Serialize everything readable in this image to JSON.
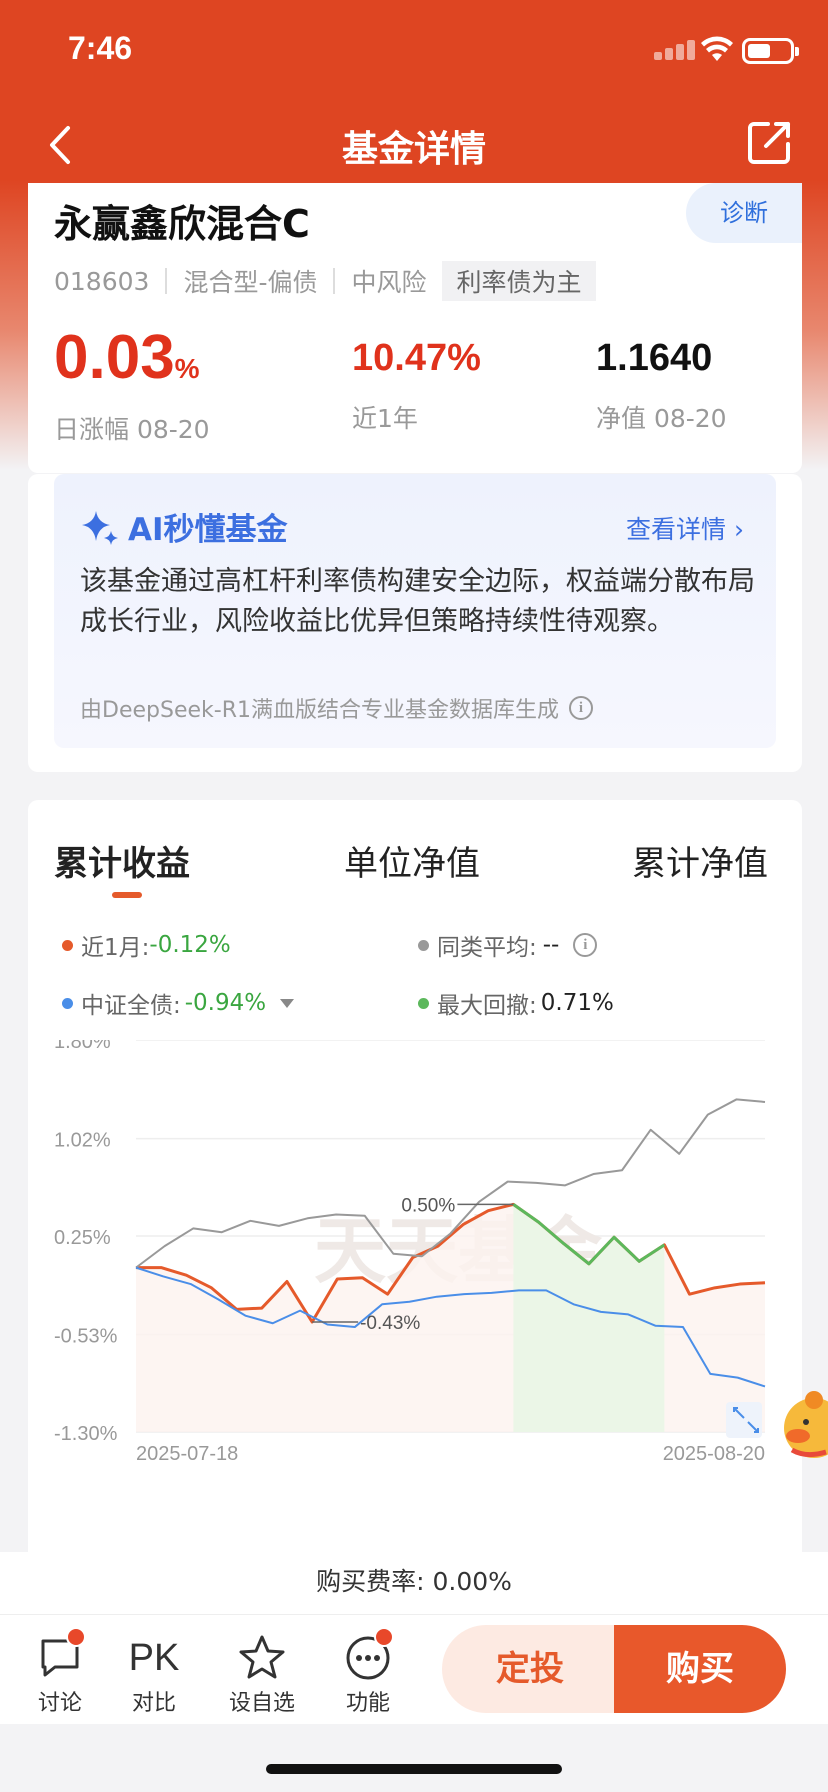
{
  "status_bar": {
    "time": "7:46"
  },
  "nav": {
    "title": "基金详情"
  },
  "fund": {
    "name": "永赢鑫欣混合C",
    "diagnose_label": "诊断",
    "code": "018603",
    "type": "混合型-偏债",
    "risk": "中风险",
    "tag": "利率债为主",
    "daily_change": "0.03",
    "daily_change_unit": "%",
    "daily_label": "日涨幅 08-20",
    "year_return": "10.47%",
    "year_label": "近1年",
    "nav_value": "1.1640",
    "nav_label": "净值 08-20"
  },
  "ai": {
    "title": "AI秒懂基金",
    "more": "查看详情",
    "text": "该基金通过高杠杆利率债构建安全边际，权益端分散布局成长行业，风险收益比优异但策略持续性待观察。",
    "footer": "由DeepSeek-R1满血版结合专业基金数据库生成"
  },
  "chart_tabs": [
    "累计收益",
    "单位净值",
    "累计净值"
  ],
  "legend": {
    "month_label": "近1月:",
    "month_value": "-0.12%",
    "peer_label": "同类平均:",
    "peer_value": "--",
    "index_label": "中证全债:",
    "index_value": "-0.94%",
    "drawdown_label": "最大回撤:",
    "drawdown_value": "0.71%"
  },
  "colors": {
    "fund": "#e55a2b",
    "peer": "#999999",
    "index": "#4a8ee8",
    "drawdown": "#5cb85c",
    "accent": "#de4522"
  },
  "chart_data": {
    "type": "line",
    "x_start": "2025-07-18",
    "x_end": "2025-08-20",
    "ylim": [
      -1.3,
      1.8
    ],
    "yticks": [
      "1.80%",
      "1.02%",
      "0.25%",
      "-0.53%",
      "-1.30%"
    ],
    "ytick_values": [
      1.8,
      1.02,
      0.25,
      -0.53,
      -1.3
    ],
    "watermark": "天天基金",
    "series": [
      {
        "name": "近1月",
        "values": [
          0.0,
          0.0,
          -0.06,
          -0.16,
          -0.33,
          -0.32,
          -0.11,
          -0.43,
          -0.09,
          -0.08,
          -0.21,
          0.08,
          0.17,
          0.34,
          0.45,
          0.5,
          0.36,
          0.19,
          0.03,
          0.24,
          0.05,
          0.18,
          -0.21,
          -0.16,
          -0.13,
          -0.12
        ]
      },
      {
        "name": "同类平均",
        "values": [
          0.0,
          0.17,
          0.31,
          0.28,
          0.37,
          0.33,
          0.39,
          0.42,
          0.41,
          0.11,
          0.09,
          0.27,
          0.52,
          0.68,
          0.67,
          0.65,
          0.74,
          0.77,
          1.09,
          0.9,
          1.21,
          1.33,
          1.31
        ]
      },
      {
        "name": "中证全债",
        "values": [
          0.0,
          -0.07,
          -0.13,
          -0.25,
          -0.38,
          -0.44,
          -0.34,
          -0.45,
          -0.47,
          -0.29,
          -0.27,
          -0.23,
          -0.21,
          -0.2,
          -0.18,
          -0.18,
          -0.29,
          -0.35,
          -0.37,
          -0.46,
          -0.47,
          -0.84,
          -0.87,
          -0.94
        ]
      }
    ],
    "annotations": [
      {
        "label": "0.50%",
        "index": 15,
        "value": 0.5
      },
      {
        "label": "-0.43%",
        "index": 7,
        "value": -0.43
      }
    ],
    "drawdown_range": [
      15,
      21
    ]
  },
  "fee": {
    "text": "购买费率: 0.00%"
  },
  "bottom_bar": {
    "discuss": "讨论",
    "compare_icon": "PK",
    "compare": "对比",
    "watchlist": "设自选",
    "function": "功能",
    "sip": "定投",
    "buy": "购买"
  }
}
